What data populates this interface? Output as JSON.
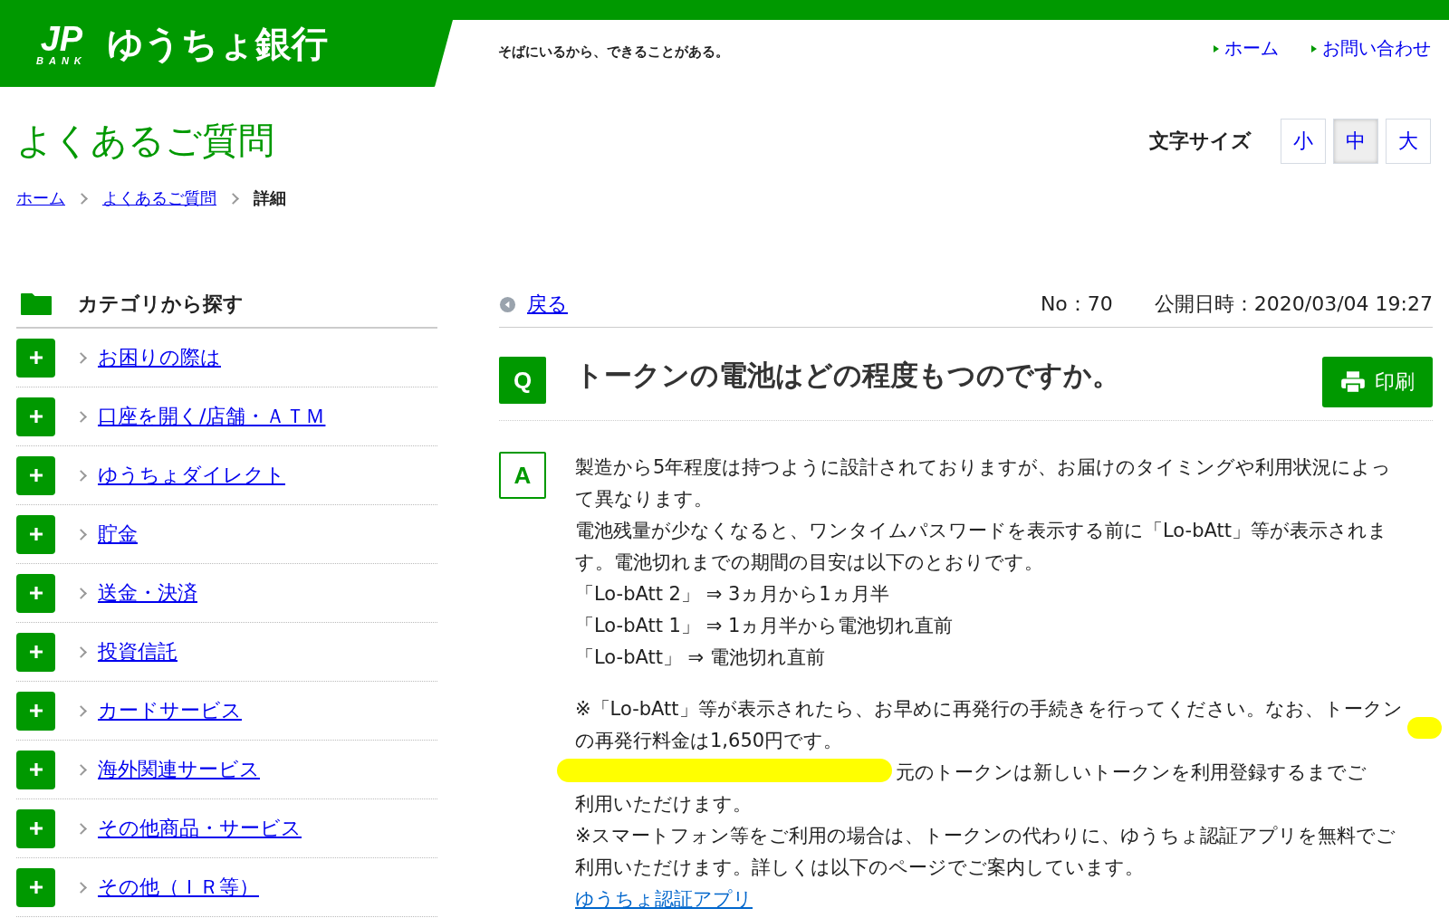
{
  "header": {
    "logo_mark": "JP",
    "logo_sub": "BANK",
    "logo_name": "ゆうちょ銀行",
    "tagline": "そばにいるから、できることがある。",
    "nav": [
      "ホーム",
      "お問い合わせ"
    ]
  },
  "page_title": "よくあるご質問",
  "text_size": {
    "label": "文字サイズ",
    "options": [
      {
        "label": "小",
        "selected": false
      },
      {
        "label": "中",
        "selected": true
      },
      {
        "label": "大",
        "selected": false
      }
    ]
  },
  "breadcrumb": [
    {
      "label": "ホーム",
      "kind": "link"
    },
    {
      "label": "よくあるご質問",
      "kind": "link"
    },
    {
      "label": "詳細",
      "kind": "current"
    }
  ],
  "sidebar": {
    "heading": "カテゴリから探す",
    "items": [
      {
        "label": "お困りの際は"
      },
      {
        "label": "口座を開く/店舗・ＡＴＭ"
      },
      {
        "label": "ゆうちょダイレクト"
      },
      {
        "label": "貯金"
      },
      {
        "label": "送金・決済"
      },
      {
        "label": "投資信託"
      },
      {
        "label": "カードサービス"
      },
      {
        "label": "海外関連サービス"
      },
      {
        "label": "その他商品・サービス"
      },
      {
        "label": "その他（ＩＲ等）"
      }
    ]
  },
  "faq": {
    "back": "戻る",
    "number": "No：70",
    "published": "公開日時：2020/03/04 19:27",
    "q_badge": "Q",
    "question": "トークンの電池はどの程度もつのですか。",
    "print": "印刷",
    "a_badge": "A",
    "answer": [
      {
        "kind": "text",
        "text": "製造から5年程度は持つように設計されておりますが、お届けのタイミングや利用状況によって異なります。"
      },
      {
        "kind": "text",
        "text": "電池残量が少なくなると、ワンタイムパスワードを表示する前に「Lo-bAtt」等が表示されます。電池切れまでの期間の目安は以下のとおりです。"
      },
      {
        "kind": "text",
        "text": "「Lo-bAtt 2」 ⇒ 3ヵ月から1ヵ月半"
      },
      {
        "kind": "text",
        "text": "「Lo-bAtt 1」 ⇒ 1ヵ月半から電池切れ直前"
      },
      {
        "kind": "text",
        "text": "「Lo-bAtt」 ⇒ 電池切れ直前"
      },
      {
        "kind": "gap"
      },
      {
        "kind": "text",
        "text": "※「Lo-bAtt」等が表示されたら、お早めに再発行の手続きを行ってください。なお、トークンの再発行料金は1,650円です。"
      },
      {
        "kind": "covered",
        "text": "元のトークンは新しいトークンを利用登録するまでご",
        "continued": "利用いただけます。"
      },
      {
        "kind": "text",
        "text": "※スマートフォン等をご利用の場合は、トークンの代わりに、ゆうちょ認証アプリを無料でご利用いただけます。詳しくは以下のページでご案内しています。"
      },
      {
        "kind": "link",
        "text": "ゆうちょ認証アプリ"
      }
    ]
  }
}
